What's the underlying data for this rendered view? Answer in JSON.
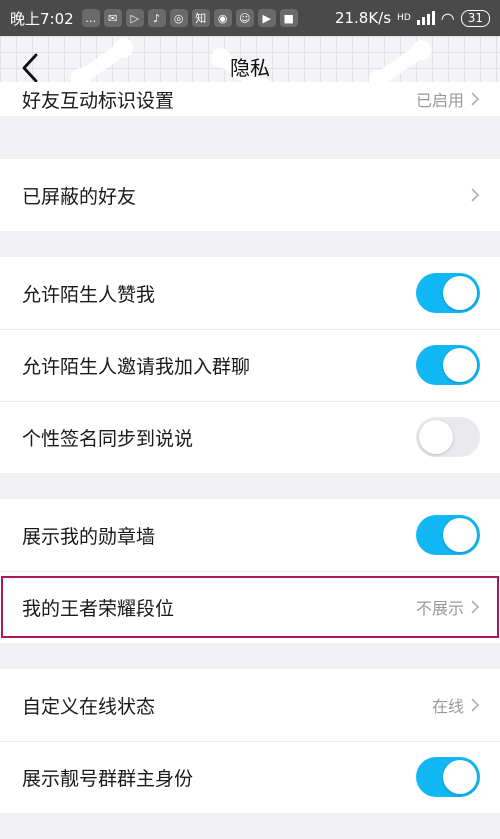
{
  "status_bar": {
    "time": "晚上7:02",
    "network_speed": "21.8K/s",
    "signal_label": "HD",
    "battery": "31",
    "app_icons": [
      "chat-icon",
      "mail-icon",
      "play-icon",
      "tiktok-icon",
      "weibo-icon",
      "zhihu-icon",
      "camera-icon",
      "smile-icon",
      "video-icon",
      "gift-icon"
    ]
  },
  "header": {
    "title": "隐私",
    "back_icon": "chevron-left-icon"
  },
  "groups": [
    {
      "rows": [
        {
          "label": "好友互动标识设置",
          "value": "已启用",
          "type": "link"
        }
      ]
    },
    {
      "rows": [
        {
          "label": "已屏蔽的好友",
          "value": "",
          "type": "link"
        }
      ]
    },
    {
      "rows": [
        {
          "label": "允许陌生人赞我",
          "type": "toggle",
          "on": true
        },
        {
          "label": "允许陌生人邀请我加入群聊",
          "type": "toggle",
          "on": true
        },
        {
          "label": "个性签名同步到说说",
          "type": "toggle",
          "on": false
        }
      ]
    },
    {
      "rows": [
        {
          "label": "展示我的勋章墙",
          "type": "toggle",
          "on": true
        },
        {
          "label": "我的王者荣耀段位",
          "value": "不展示",
          "type": "link",
          "highlighted": true
        }
      ]
    },
    {
      "rows": [
        {
          "label": "自定义在线状态",
          "value": "在线",
          "type": "link"
        },
        {
          "label": "展示靓号群群主身份",
          "type": "toggle",
          "on": true
        }
      ]
    }
  ],
  "colors": {
    "toggle_on": "#12b7f5",
    "toggle_off": "#e9e9ee",
    "highlight_border": "#a8195c",
    "background": "#f1f1f3"
  }
}
